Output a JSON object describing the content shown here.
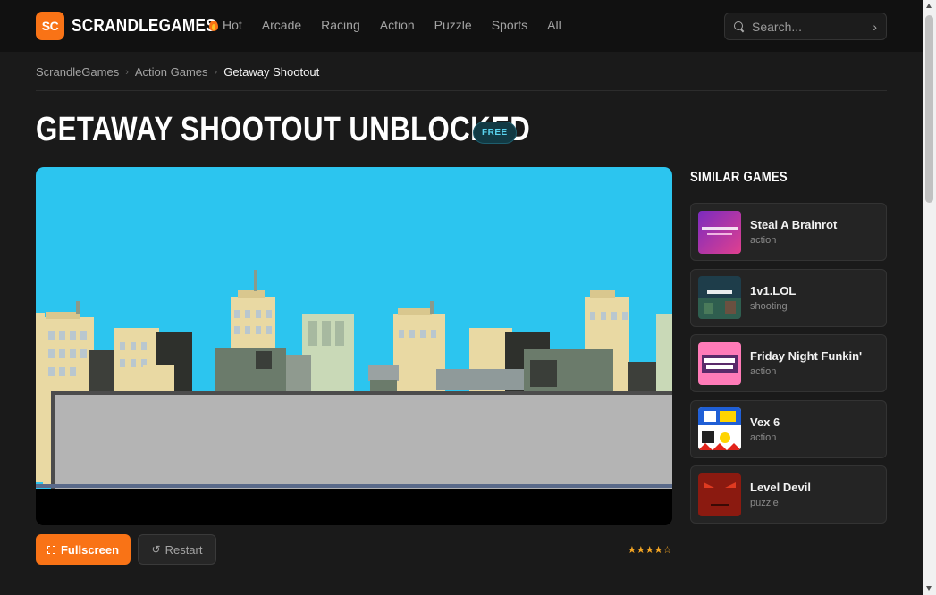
{
  "header": {
    "logo_badge": "SC",
    "logo_text": "SCRANDLEGAMES",
    "nav": [
      {
        "label": "Hot",
        "icon": "fire-icon"
      },
      {
        "label": "Arcade"
      },
      {
        "label": "Racing"
      },
      {
        "label": "Action"
      },
      {
        "label": "Puzzle"
      },
      {
        "label": "Sports"
      },
      {
        "label": "All"
      }
    ],
    "search": {
      "placeholder": "Search...",
      "value": "",
      "go_icon": "chevron-right-icon"
    }
  },
  "breadcrumb": [
    "ScrandleGames",
    "Action Games",
    "Getaway Shootout"
  ],
  "page": {
    "title": "GETAWAY SHOOTOUT UNBLOCKED",
    "badge": "FREE"
  },
  "controls": {
    "fullscreen_label": "Fullscreen",
    "restart_label": "Restart",
    "rating_stars": "★★★★☆",
    "rating_value": 4
  },
  "sidebar": {
    "title": "SIMILAR GAMES",
    "games": [
      {
        "name": "Steal A Brainrot",
        "category": "action",
        "thumb_color": "#b5338a"
      },
      {
        "name": "1v1.LOL",
        "category": "shooting",
        "thumb_color": "#2f5e4f"
      },
      {
        "name": "Friday Night Funkin'",
        "category": "action",
        "thumb_color": "#ff7bb8"
      },
      {
        "name": "Vex 6",
        "category": "action",
        "thumb_color": "#1f5fd6"
      },
      {
        "name": "Level Devil",
        "category": "puzzle",
        "thumb_color": "#8b1a10"
      }
    ]
  },
  "colors": {
    "accent": "#f97316",
    "background": "#1a1a1a",
    "header": "#111111",
    "sky": "#2cc5ef",
    "badge_text": "#5ad3ee"
  }
}
